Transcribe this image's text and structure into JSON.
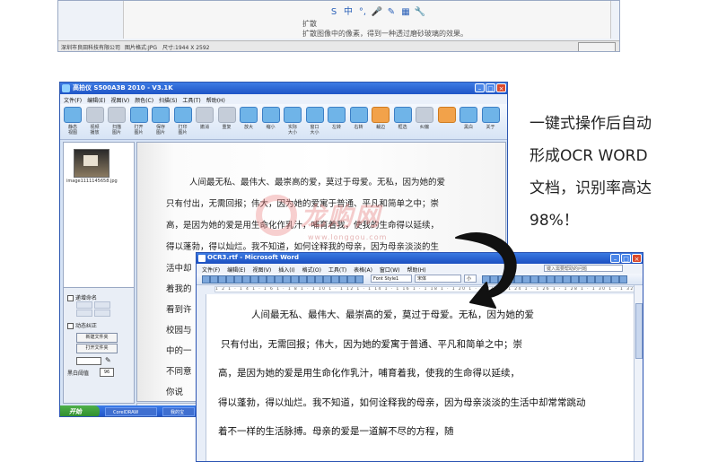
{
  "top_screenshot": {
    "toolbar_icons": [
      "S-icon",
      "中",
      "·,",
      "mic-icon",
      "edit-icon",
      "table-icon",
      "wrench-icon"
    ],
    "text_line1": "扩散",
    "text_line2": "扩散图像中的像素，得到一种透过磨砂玻璃的效果。",
    "status_company": "深圳市良田科技有限公司",
    "status_format": "图片格式:JPG",
    "status_size": "尺寸:1944 X 2592"
  },
  "main_window": {
    "title": "高拍仪 S500A3B 2010 - V3.1K",
    "menu": [
      "文件(F)",
      "编辑(E)",
      "视图(V)",
      "颜色(C)",
      "扫描(S)",
      "工具(T)",
      "帮助(H)"
    ],
    "toolbar": [
      {
        "label": "静态\n视图",
        "style": "blue"
      },
      {
        "label": "视频\n播放",
        "style": "gray"
      },
      {
        "label": "扫描\n图片",
        "style": "gray"
      },
      {
        "label": "打开\n图片",
        "style": "blue"
      },
      {
        "label": "保存\n图片",
        "style": "blue"
      },
      {
        "label": "打印\n图片",
        "style": "blue"
      },
      {
        "label": "撤消",
        "style": "gray"
      },
      {
        "label": "重复",
        "style": "gray"
      },
      {
        "label": "放大",
        "style": "blue"
      },
      {
        "label": "缩小",
        "style": "blue"
      },
      {
        "label": "实际\n大小",
        "style": "blue"
      },
      {
        "label": "窗口\n大小",
        "style": "blue"
      },
      {
        "label": "左转",
        "style": "blue"
      },
      {
        "label": "右转",
        "style": "blue"
      },
      {
        "label": "裁边",
        "style": "orange"
      },
      {
        "label": "框选",
        "style": "blue"
      },
      {
        "label": "纠偏",
        "style": "gray"
      },
      {
        "label": "",
        "style": "orange"
      },
      {
        "label": "黑白",
        "style": "blue"
      },
      {
        "label": "关于",
        "style": "blue"
      }
    ],
    "thumbnail_name": "image1111145658.jpg",
    "controls": {
      "auto_name_checkbox": "递增命名",
      "auto_deskew_checkbox": "动态纠正",
      "new_folder_button": "新建文件夹",
      "open_folder_button": "打开文件夹",
      "threshold_label": "黑白阈值",
      "threshold_value": "96"
    },
    "doc_lines": [
      "人间最无私、最伟大、最崇高的爱，莫过于母爱。无私，因为她的爱",
      "只有付出，无需回报；伟大，因为她的爱寓于普通、平凡和简单之中；崇",
      "高，是因为她的爱是用生命化作乳汁，哺育着我，使我的生命得以延续，",
      "得以蓬勃，得以灿烂。我不知道，如何诠释我的母亲，因为母亲淡淡的生",
      "活中却",
      "着我的",
      "看到许",
      "校园与",
      "中的一",
      "不同意",
      "你说"
    ],
    "taskbar": {
      "start": "开始",
      "tasks": [
        "CorelDRAW",
        "我的宝"
      ]
    }
  },
  "word_window": {
    "title": "OCR3.rtf - Microsoft Word",
    "menu": [
      "文件(F)",
      "编辑(E)",
      "视图(V)",
      "插入(I)",
      "格式(O)",
      "工具(T)",
      "表格(A)",
      "窗口(W)",
      "帮助(H)"
    ],
    "help_placeholder": "键入需要帮助的问题",
    "style_box": "Font Style1",
    "font_box": "宋体",
    "size_box": "小",
    "ruler_text": "1 2 1 · 1 4 1 · 1 6 1 · 1 8 1 · 1 10 1 · 1 12 1 · 1 14 1 · 1 16 1 · 1 18 1 · 1 20 1 · 1 22 1 · 1 24 1 · 1 26 1 · 1 28 1 · 1 30 1 · 1 32 1 · 1 34 1 · 1 36 1 · 1 38 1",
    "lines": [
      "人间最无私、最伟大、最崇高的爱，莫过于母爱。无私，因为她的爱",
      "只有付出，无需回报；伟大，因为她的爱寓于普通、平凡和简单之中；崇",
      "高，是因为她的爱是用生命化作乳汁，哺育着我，使我的生命得以延续，",
      "得以蓬勃，得以灿烂。我不知道，如何诠释我的母亲，因为母亲淡淡的生活中却常常跳动",
      "着不一样的生活脉搏。母亲的爱是一道解不尽的方程，随"
    ]
  },
  "watermark": {
    "brand": "龙购网",
    "url": "www.longgou.com"
  },
  "caption": [
    "一键式操作后自动",
    "形成OCR WORD",
    "文档，识别率高达",
    "98%！"
  ]
}
